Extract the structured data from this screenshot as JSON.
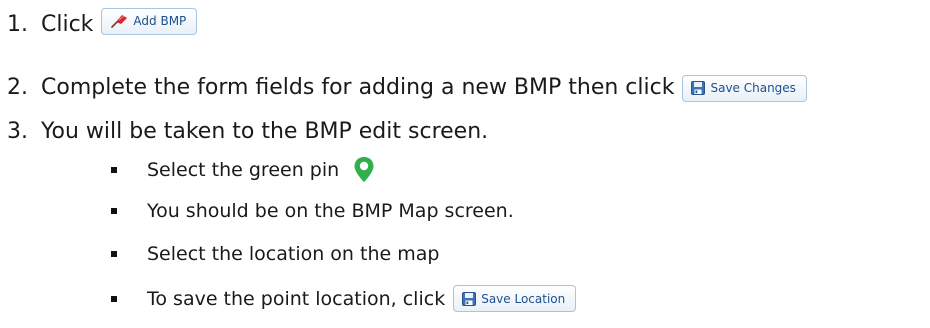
{
  "steps": [
    {
      "number": "1.",
      "text": "Click",
      "button": {
        "label": "Add BMP",
        "icon": "pushpin-icon"
      }
    },
    {
      "number": "2.",
      "text": "Complete the form fields for adding a new BMP then click",
      "button": {
        "label": "Save Changes",
        "icon": "floppy-disk-icon"
      }
    },
    {
      "number": "3.",
      "text": "You will be taken to the BMP edit screen."
    }
  ],
  "substeps": [
    {
      "text": "Select the green pin",
      "icon": "map-pin-icon",
      "icon_color": "#2fb04a"
    },
    {
      "text": "You should be on the BMP Map screen."
    },
    {
      "text": "Select the location on the map"
    },
    {
      "text": "To save the point location, click",
      "button": {
        "label": "Save Location",
        "icon": "floppy-disk-icon"
      }
    }
  ],
  "colors": {
    "button_border": "#a9c4de",
    "button_text": "#1e4f8f",
    "pin_green": "#2fb04a",
    "pushpin_red": "#d8232a"
  }
}
